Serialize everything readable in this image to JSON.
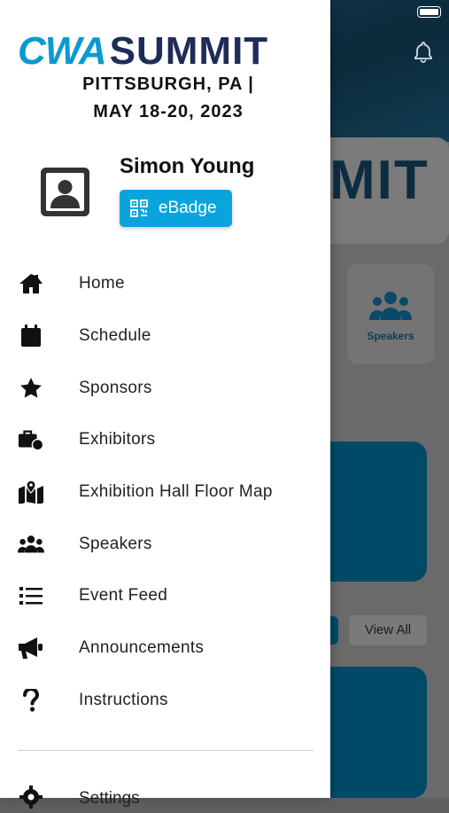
{
  "drawer": {
    "logo": {
      "brand_a": "CWA",
      "brand_b": "SUMMIT",
      "location": "PITTSBURGH, PA |",
      "dates": "MAY 18-20, 2023"
    },
    "user": {
      "name": "Simon Young",
      "badge_label": "eBadge"
    },
    "menu": [
      {
        "label": "Home",
        "icon": "home-icon"
      },
      {
        "label": "Schedule",
        "icon": "calendar-icon"
      },
      {
        "label": "Sponsors",
        "icon": "star-icon"
      },
      {
        "label": "Exhibitors",
        "icon": "briefcase-icon"
      },
      {
        "label": "Exhibition Hall Floor Map",
        "icon": "map-icon"
      },
      {
        "label": "Speakers",
        "icon": "users-icon"
      },
      {
        "label": "Event Feed",
        "icon": "list-icon"
      },
      {
        "label": "Announcements",
        "icon": "megaphone-icon"
      },
      {
        "label": "Instructions",
        "icon": "question-icon"
      }
    ],
    "settings_label": "Settings"
  },
  "background": {
    "hero_text": "MIT",
    "tile_label": "Speakers",
    "view_all_label": "View All"
  },
  "colors": {
    "accent": "#0aa4dc",
    "brand_dark": "#1f2c59",
    "brand_blue": "#0a9ad2"
  }
}
